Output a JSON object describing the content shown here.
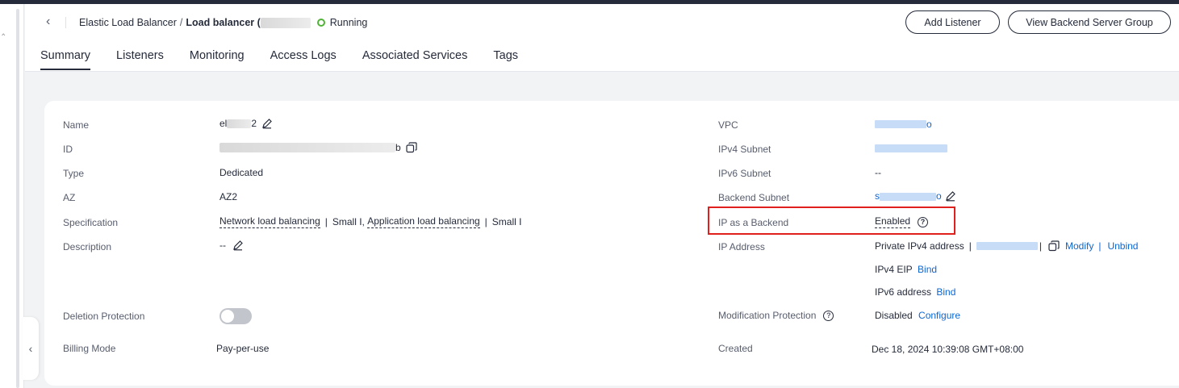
{
  "header": {
    "breadcrumb_parent": "Elastic Load Balancer",
    "breadcrumb_separator": "/",
    "breadcrumb_current": "Load balancer (",
    "status": "Running",
    "status_color": "#50b337",
    "actions": {
      "add_listener": "Add Listener",
      "view_backend": "View Backend Server Group"
    }
  },
  "tabs": [
    {
      "label": "Summary",
      "active": true
    },
    {
      "label": "Listeners",
      "active": false
    },
    {
      "label": "Monitoring",
      "active": false
    },
    {
      "label": "Access Logs",
      "active": false
    },
    {
      "label": "Associated Services",
      "active": false
    },
    {
      "label": "Tags",
      "active": false
    }
  ],
  "left": {
    "name": {
      "label": "Name",
      "value_prefix": "el",
      "value_suffix": "2"
    },
    "id": {
      "label": "ID",
      "value_suffix": "b"
    },
    "type": {
      "label": "Type",
      "value": "Dedicated"
    },
    "az": {
      "label": "AZ",
      "value": "AZ2"
    },
    "spec": {
      "label": "Specification",
      "network": "Network load balancing",
      "small1": "Small I,",
      "application": "Application load balancing",
      "small2": "Small I",
      "pipe": "|"
    },
    "description": {
      "label": "Description",
      "value": "--"
    },
    "deletion_protection": {
      "label": "Deletion Protection",
      "enabled": false
    },
    "billing_mode": {
      "label": "Billing Mode",
      "value": "Pay-per-use"
    }
  },
  "right": {
    "vpc": {
      "label": "VPC",
      "value_suffix": "o"
    },
    "ipv4_subnet": {
      "label": "IPv4 Subnet"
    },
    "ipv6_subnet": {
      "label": "IPv6 Subnet",
      "value": "--"
    },
    "backend_subnet": {
      "label": "Backend Subnet",
      "value_prefix": "s",
      "value_suffix": "o"
    },
    "ip_backend": {
      "label": "IP as a Backend",
      "value": "Enabled"
    },
    "ip_address": {
      "label": "IP Address",
      "private_ipv4": "Private IPv4 address",
      "pipe": "|",
      "modify": "Modify",
      "unbind": "Unbind",
      "ipv4_eip": "IPv4 EIP",
      "ipv6_address": "IPv6 address",
      "bind": "Bind"
    },
    "modification_protection": {
      "label": "Modification Protection",
      "value": "Disabled",
      "configure": "Configure"
    },
    "created": {
      "label": "Created",
      "value": "Dec 18, 2024 10:39:08 GMT+08:00"
    }
  },
  "icons": [
    "back-icon",
    "status-running-icon",
    "edit-icon",
    "copy-icon",
    "help-icon",
    "collapse-chevron-icon"
  ],
  "colors": {
    "link": "#0e66d0",
    "highlight": "#e0201c"
  }
}
